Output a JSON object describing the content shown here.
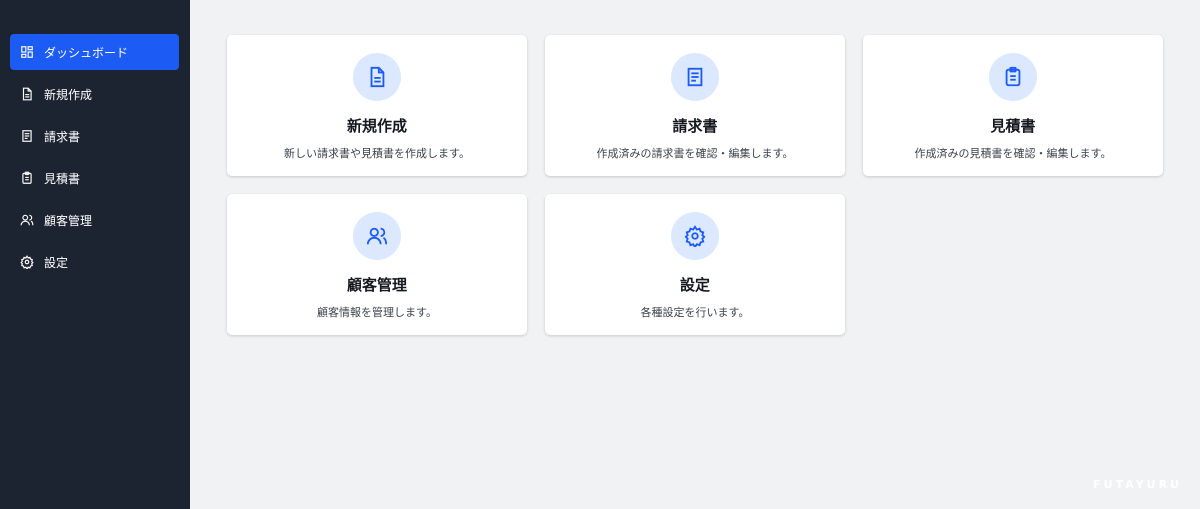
{
  "sidebar": {
    "items": [
      {
        "label": "ダッシュボード",
        "icon": "dashboard-icon",
        "active": true
      },
      {
        "label": "新規作成",
        "icon": "document-icon"
      },
      {
        "label": "請求書",
        "icon": "receipt-icon"
      },
      {
        "label": "見積書",
        "icon": "clipboard-icon"
      },
      {
        "label": "顧客管理",
        "icon": "users-icon"
      },
      {
        "label": "設定",
        "icon": "gear-icon"
      }
    ]
  },
  "cards": [
    {
      "title": "新規作成",
      "desc": "新しい請求書や見積書を作成します。",
      "icon": "document-icon"
    },
    {
      "title": "請求書",
      "desc": "作成済みの請求書を確認・編集します。",
      "icon": "receipt-icon"
    },
    {
      "title": "見積書",
      "desc": "作成済みの見積書を確認・編集します。",
      "icon": "clipboard-icon"
    },
    {
      "title": "顧客管理",
      "desc": "顧客情報を管理します。",
      "icon": "users-icon"
    },
    {
      "title": "設定",
      "desc": "各種設定を行います。",
      "icon": "gear-icon"
    }
  ],
  "watermark": "FUTAYURU",
  "colors": {
    "sidebar_bg": "#1d2431",
    "accent": "#1c5cf5",
    "icon_circle": "#dbe8fe",
    "page_bg": "#f1f2f4"
  }
}
